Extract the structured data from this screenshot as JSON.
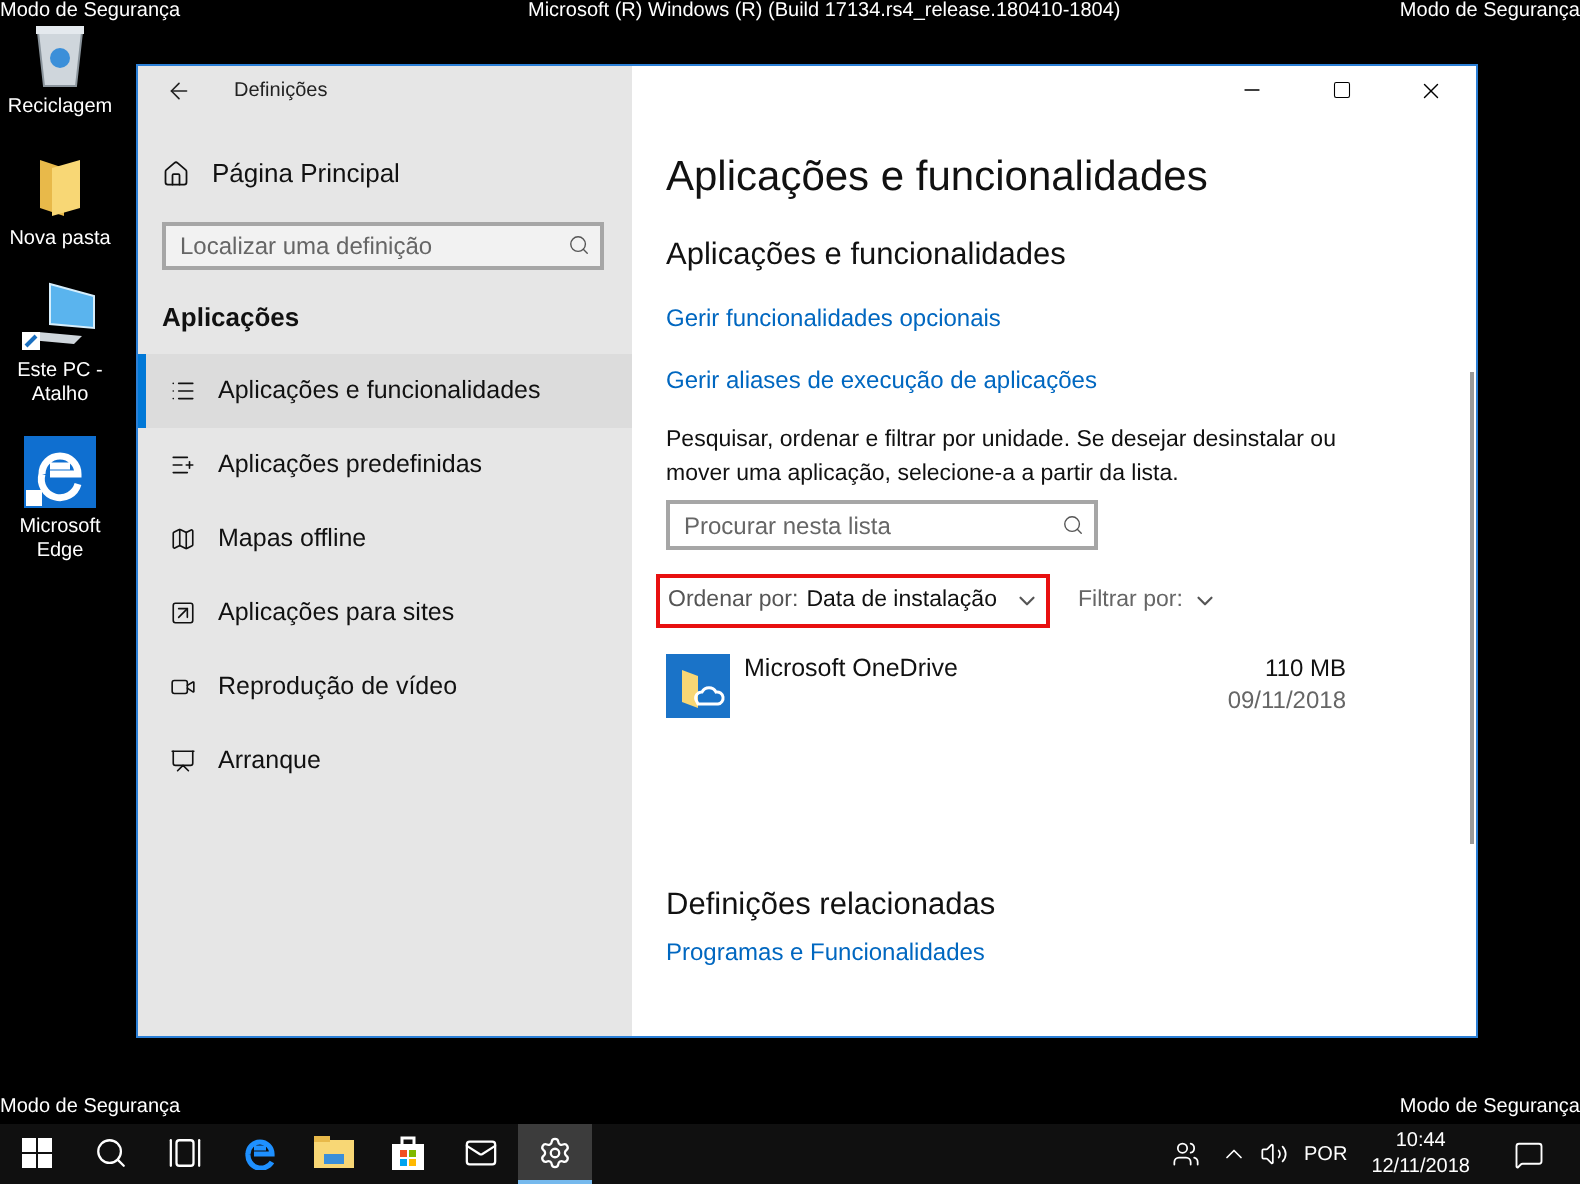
{
  "overlay_texts": {
    "top_left": "Modo de Segurança",
    "top_center": "Microsoft (R) Windows (R) (Build 17134.rs4_release.180410-1804)",
    "top_right": "Modo de Segurança",
    "bottom_left": "Modo de Segurança",
    "bottom_right": "Modo de Segurança"
  },
  "desktop_icons": [
    {
      "label": "Reciclagem",
      "kind": "recycle"
    },
    {
      "label": "Nova pasta",
      "kind": "folder"
    },
    {
      "label": "Este PC - Atalho",
      "kind": "pc"
    },
    {
      "label": "Microsoft Edge",
      "kind": "edge"
    }
  ],
  "window": {
    "title": "Definições",
    "sidebar": {
      "home": "Página Principal",
      "search_placeholder": "Localizar uma definição",
      "section": "Aplicações",
      "items": [
        {
          "label": "Aplicações e funcionalidades",
          "kind": "list",
          "selected": true
        },
        {
          "label": "Aplicações predefinidas",
          "kind": "defaults",
          "selected": false
        },
        {
          "label": "Mapas offline",
          "kind": "map",
          "selected": false
        },
        {
          "label": "Aplicações para sites",
          "kind": "sites",
          "selected": false
        },
        {
          "label": "Reprodução de vídeo",
          "kind": "video",
          "selected": false
        },
        {
          "label": "Arranque",
          "kind": "startup",
          "selected": false
        }
      ]
    },
    "content": {
      "title": "Aplicações e funcionalidades",
      "subtitle": "Aplicações e funcionalidades",
      "links": [
        "Gerir funcionalidades opcionais",
        "Gerir aliases de execução de aplicações"
      ],
      "description": "Pesquisar, ordenar e filtrar por unidade. Se desejar desinstalar ou mover uma aplicação, selecione-a a partir da lista.",
      "search_placeholder": "Procurar nesta lista",
      "sort": {
        "label": "Ordenar por:",
        "value": "Data de instalação",
        "highlighted": true
      },
      "filter": {
        "label": "Filtrar por:"
      },
      "apps": [
        {
          "name": "Microsoft OneDrive",
          "size": "110 MB",
          "date": "09/11/2018"
        }
      ],
      "related_heading": "Definições relacionadas",
      "related_links": [
        "Programas e Funcionalidades"
      ]
    }
  },
  "taskbar": {
    "items": [
      {
        "kind": "start",
        "selected": false
      },
      {
        "kind": "search",
        "selected": false
      },
      {
        "kind": "taskview",
        "selected": false
      },
      {
        "kind": "edge",
        "selected": false
      },
      {
        "kind": "explorer",
        "selected": false
      },
      {
        "kind": "store",
        "selected": false
      },
      {
        "kind": "mail",
        "selected": false
      },
      {
        "kind": "settings",
        "selected": true
      }
    ],
    "language": "POR",
    "time": "10:44",
    "date": "12/11/2018"
  }
}
